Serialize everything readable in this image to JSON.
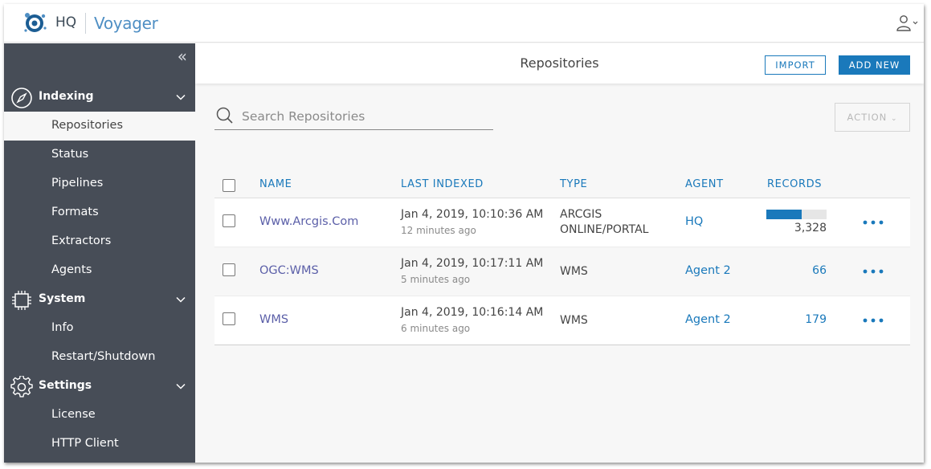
{
  "app": {
    "hq_label": "HQ",
    "brand_name": "Voyager"
  },
  "sidebar": {
    "collapse_glyph": "«",
    "sections": [
      {
        "label": "Indexing",
        "icon": "compass-icon",
        "items": [
          "Repositories",
          "Status",
          "Pipelines",
          "Formats",
          "Extractors",
          "Agents"
        ]
      },
      {
        "label": "System",
        "icon": "chip-icon",
        "items": [
          "Info",
          "Restart/Shutdown"
        ]
      },
      {
        "label": "Settings",
        "icon": "gear-icon",
        "items": [
          "License",
          "HTTP Client"
        ]
      }
    ],
    "active_item": "Repositories"
  },
  "header": {
    "title": "Repositories",
    "import_label": "IMPORT",
    "add_new_label": "ADD NEW"
  },
  "search": {
    "placeholder": "Search Repositories",
    "value": ""
  },
  "action_label": "ACTION",
  "table": {
    "columns": [
      "NAME",
      "LAST INDEXED",
      "TYPE",
      "AGENT",
      "RECORDS"
    ],
    "rows": [
      {
        "name": "Www.Arcgis.Com",
        "last_indexed": "Jan 4, 2019, 10:10:36 AM",
        "ago": "12 minutes ago",
        "type_line1": "ARCGIS",
        "type_line2": "ONLINE/PORTAL",
        "agent": "HQ",
        "records": "3,328",
        "progress": 0.58
      },
      {
        "name": "OGC:WMS",
        "last_indexed": "Jan 4, 2019, 10:17:11 AM",
        "ago": "5 minutes ago",
        "type_line1": "WMS",
        "type_line2": "",
        "agent": "Agent 2",
        "records": "66"
      },
      {
        "name": "WMS",
        "last_indexed": "Jan 4, 2019, 10:16:14 AM",
        "ago": "6 minutes ago",
        "type_line1": "WMS",
        "type_line2": "",
        "agent": "Agent 2",
        "records": "179"
      }
    ]
  },
  "colors": {
    "accent": "#1a79bb",
    "sidebar_bg": "#474d57",
    "name_link": "#5b5fa8"
  }
}
